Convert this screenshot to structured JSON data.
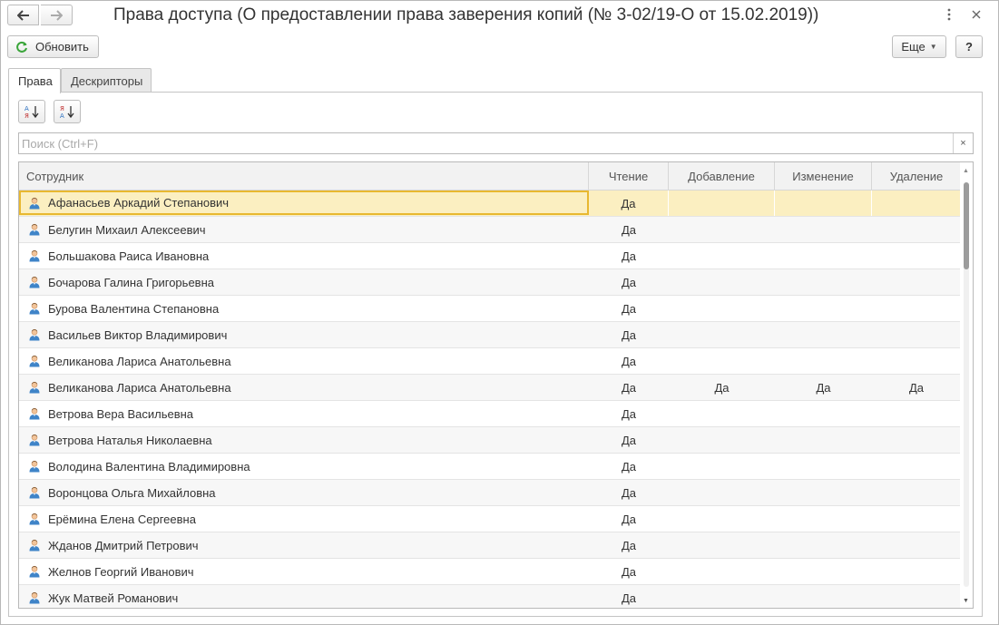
{
  "window": {
    "title": "Права доступа (О предоставлении права заверения копий (№ 3-02/19-О от 15.02.2019))",
    "more_icon": "vertical-dots-icon",
    "close_icon": "close-icon"
  },
  "toolbar": {
    "refresh_label": "Обновить",
    "more_label": "Еще",
    "help_label": "?"
  },
  "tabs": [
    {
      "label": "Права",
      "active": true
    },
    {
      "label": "Дескрипторы",
      "active": false
    }
  ],
  "search": {
    "placeholder": "Поиск (Ctrl+F)",
    "value": "",
    "clear_label": "×"
  },
  "table": {
    "columns": [
      "Сотрудник",
      "Чтение",
      "Добавление",
      "Изменение",
      "Удаление"
    ],
    "rows": [
      {
        "name": "Афанасьев Аркадий Степанович",
        "read": "Да",
        "add": "",
        "edit": "",
        "delete": "",
        "selected": true
      },
      {
        "name": "Белугин Михаил Алексеевич",
        "read": "Да",
        "add": "",
        "edit": "",
        "delete": ""
      },
      {
        "name": "Большакова Раиса Ивановна",
        "read": "Да",
        "add": "",
        "edit": "",
        "delete": ""
      },
      {
        "name": "Бочарова Галина Григорьевна",
        "read": "Да",
        "add": "",
        "edit": "",
        "delete": ""
      },
      {
        "name": "Бурова Валентина Степановна",
        "read": "Да",
        "add": "",
        "edit": "",
        "delete": ""
      },
      {
        "name": "Васильев Виктор Владимирович",
        "read": "Да",
        "add": "",
        "edit": "",
        "delete": ""
      },
      {
        "name": "Великанова Лариса Анатольевна",
        "read": "Да",
        "add": "",
        "edit": "",
        "delete": ""
      },
      {
        "name": "Великанова Лариса Анатольевна",
        "read": "Да",
        "add": "Да",
        "edit": "Да",
        "delete": "Да"
      },
      {
        "name": "Ветрова Вера Васильевна",
        "read": "Да",
        "add": "",
        "edit": "",
        "delete": ""
      },
      {
        "name": "Ветрова Наталья Николаевна",
        "read": "Да",
        "add": "",
        "edit": "",
        "delete": ""
      },
      {
        "name": "Володина Валентина Владимировна",
        "read": "Да",
        "add": "",
        "edit": "",
        "delete": ""
      },
      {
        "name": "Воронцова Ольга Михайловна",
        "read": "Да",
        "add": "",
        "edit": "",
        "delete": ""
      },
      {
        "name": "Ерёмина Елена Сергеевна",
        "read": "Да",
        "add": "",
        "edit": "",
        "delete": ""
      },
      {
        "name": "Жданов Дмитрий Петрович",
        "read": "Да",
        "add": "",
        "edit": "",
        "delete": ""
      },
      {
        "name": "Желнов Георгий Иванович",
        "read": "Да",
        "add": "",
        "edit": "",
        "delete": ""
      },
      {
        "name": "Жук Матвей Романович",
        "read": "Да",
        "add": "",
        "edit": "",
        "delete": ""
      }
    ]
  },
  "colors": {
    "selected_row": "#fbefc1",
    "selected_border": "#e8b830",
    "refresh_icon": "#3aa53a",
    "person_icon": "#3f84c8"
  }
}
